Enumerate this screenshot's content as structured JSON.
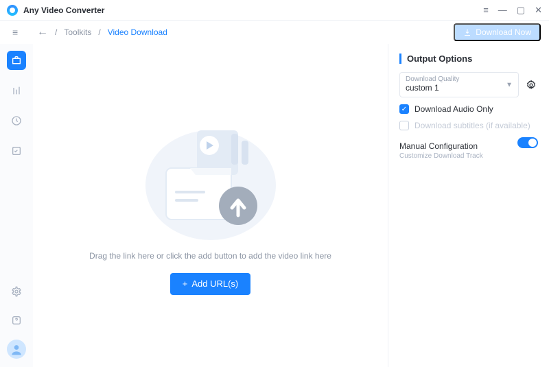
{
  "app": {
    "title": "Any Video Converter"
  },
  "breadcrumb": {
    "toolkits": "Toolkits",
    "current": "Video Download"
  },
  "toolbar": {
    "download_now": "Download Now"
  },
  "drop": {
    "caption": "Drag the link here or click the add button to add the video link here",
    "add_btn": "Add URL(s)"
  },
  "options": {
    "title": "Output Options",
    "quality_label": "Download Quality",
    "quality_value": "custom 1",
    "audio_only": "Download Audio Only",
    "subtitles": "Download subtitles (if available)",
    "manual": "Manual Configuration",
    "manual_sub": "Customize Download Track",
    "audio_only_checked": true,
    "subtitles_checked": false,
    "manual_on": true
  }
}
